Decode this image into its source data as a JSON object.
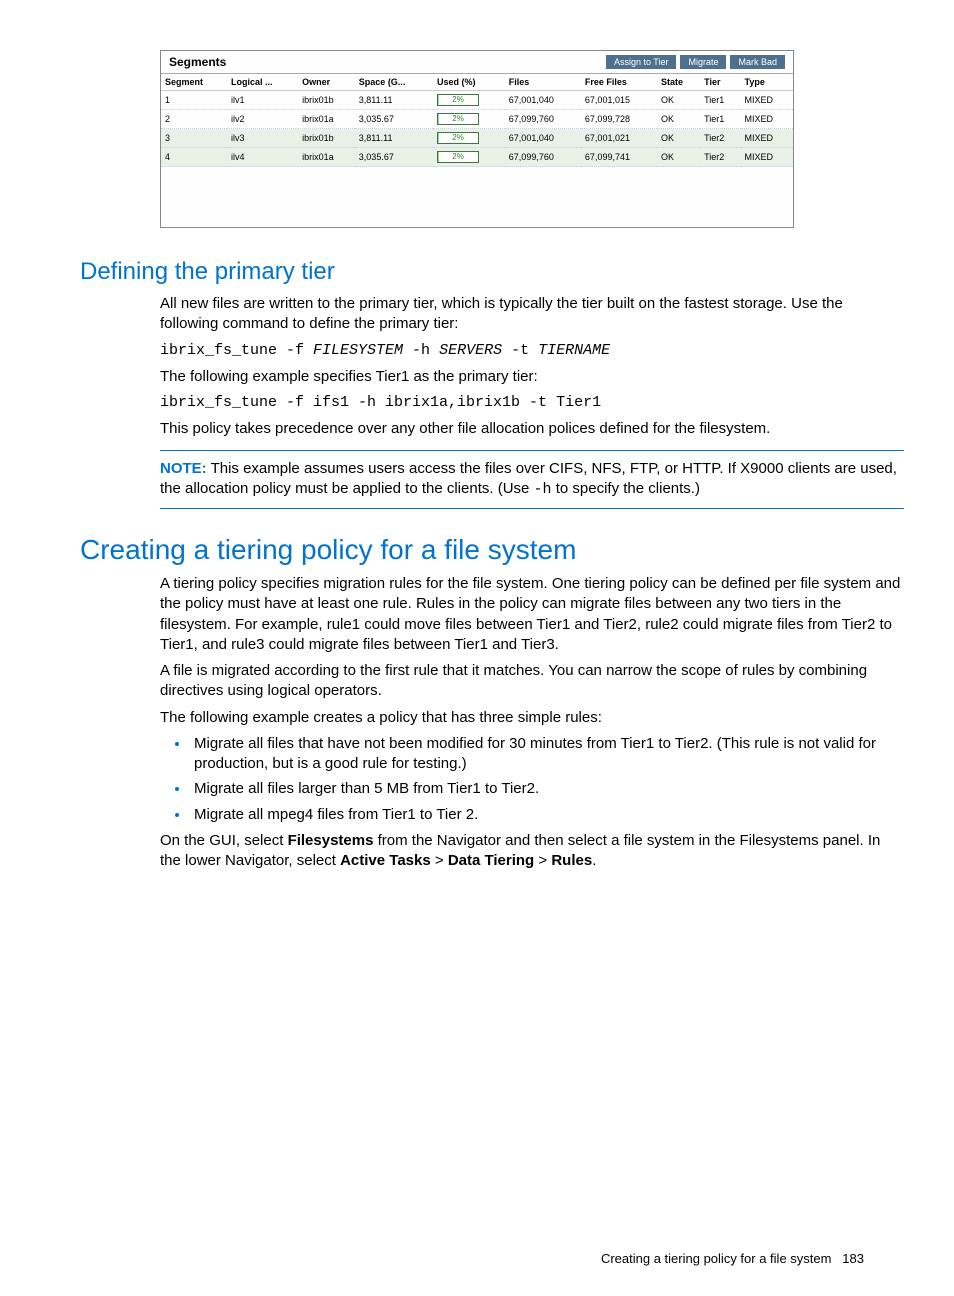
{
  "panel": {
    "title": "Segments",
    "buttons": {
      "assign": "Assign to Tier",
      "migrate": "Migrate",
      "markbad": "Mark Bad"
    },
    "headers": [
      "Segment",
      "Logical ...",
      "Owner",
      "Space (G...",
      "Used (%)",
      "Files",
      "Free Files",
      "State",
      "Tier",
      "Type"
    ],
    "rows": [
      {
        "seg": "1",
        "lv": "ilv1",
        "owner": "ibrix01b",
        "space": "3,811.11",
        "used": "2%",
        "files": "67,001,040",
        "free": "67,001,015",
        "state": "OK",
        "tier": "Tier1",
        "type": "MIXED"
      },
      {
        "seg": "2",
        "lv": "ilv2",
        "owner": "ibrix01a",
        "space": "3,035.67",
        "used": "2%",
        "files": "67,099,760",
        "free": "67,099,728",
        "state": "OK",
        "tier": "Tier1",
        "type": "MIXED"
      },
      {
        "seg": "3",
        "lv": "ilv3",
        "owner": "ibrix01b",
        "space": "3,811.11",
        "used": "2%",
        "files": "67,001,040",
        "free": "67,001,021",
        "state": "OK",
        "tier": "Tier2",
        "type": "MIXED"
      },
      {
        "seg": "4",
        "lv": "ilv4",
        "owner": "ibrix01a",
        "space": "3,035.67",
        "used": "2%",
        "files": "67,099,760",
        "free": "67,099,741",
        "state": "OK",
        "tier": "Tier2",
        "type": "MIXED"
      }
    ]
  },
  "section1": {
    "heading": "Defining the primary tier",
    "p1": "All new files are written to the primary tier, which is typically the tier built on the fastest storage. Use the following command to define the primary tier:",
    "cmd1a": "ibrix_fs_tune -f ",
    "cmd1b": "FILESYSTEM",
    "cmd1c": " -h ",
    "cmd1d": "SERVERS",
    "cmd1e": " -t ",
    "cmd1f": "TIERNAME",
    "p2": "The following example specifies Tier1 as the primary tier:",
    "cmd2": "ibrix_fs_tune -f ifs1 -h ibrix1a,ibrix1b -t Tier1",
    "p3": "This policy takes precedence over any other file allocation polices defined for the filesystem.",
    "note_label": "NOTE:",
    "note_a": " This example assumes users access the files over CIFS, NFS, FTP, or HTTP. If X9000 clients are used, the allocation policy must be applied to the clients. (Use ",
    "note_code": "-h",
    "note_b": " to specify the clients.)"
  },
  "section2": {
    "heading": "Creating a tiering policy for a file system",
    "p1": "A tiering policy specifies migration rules for the file system. One tiering policy can be defined per file system and the policy must have at least one rule. Rules in the policy can migrate files between any two tiers in the filesystem. For example, rule1 could move files between Tier1 and Tier2, rule2 could migrate files from Tier2 to Tier1, and rule3 could migrate files between Tier1 and Tier3.",
    "p2": "A file is migrated according to the first rule that it matches. You can narrow the scope of rules by combining directives using logical operators.",
    "p3": "The following example creates a policy that has three simple rules:",
    "bullets": [
      "Migrate all files that have not been modified for 30 minutes from Tier1 to Tier2. (This rule is not valid for production, but is a good rule for testing.)",
      "Migrate all files larger than 5 MB from Tier1 to Tier2.",
      "Migrate all mpeg4 files from Tier1 to Tier 2."
    ],
    "p4a": "On the GUI, select ",
    "p4b": "Filesystems",
    "p4c": " from the Navigator and then select a file system in the Filesystems panel. In the lower Navigator, select ",
    "p4d": "Active Tasks",
    "p4e": " > ",
    "p4f": "Data Tiering",
    "p4g": " > ",
    "p4h": "Rules",
    "p4i": "."
  },
  "footer": {
    "text": "Creating a tiering policy for a file system",
    "page": "183"
  }
}
